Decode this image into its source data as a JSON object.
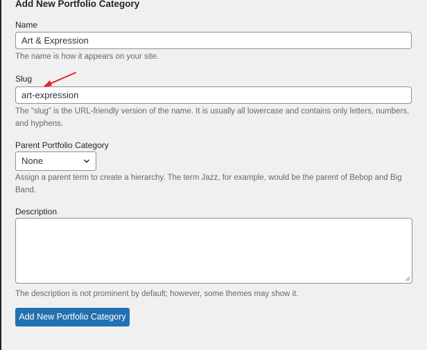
{
  "form": {
    "title": "Add New Portfolio Category",
    "name": {
      "label": "Name",
      "value": "Art & Expression",
      "help": "The name is how it appears on your site."
    },
    "slug": {
      "label": "Slug",
      "value": "art-expression",
      "help": "The “slug” is the URL-friendly version of the name. It is usually all lowercase and contains only letters, numbers, and hyphens."
    },
    "parent": {
      "label": "Parent Portfolio Category",
      "selected": "None",
      "help": "Assign a parent term to create a hierarchy. The term Jazz, for example, would be the parent of Bebop and Big Band."
    },
    "description": {
      "label": "Description",
      "value": "",
      "help": "The description is not prominent by default; however, some themes may show it."
    },
    "submit_label": "Add New Portfolio Category"
  },
  "colors": {
    "primary": "#2271b1",
    "annotation": "#e0251b"
  }
}
